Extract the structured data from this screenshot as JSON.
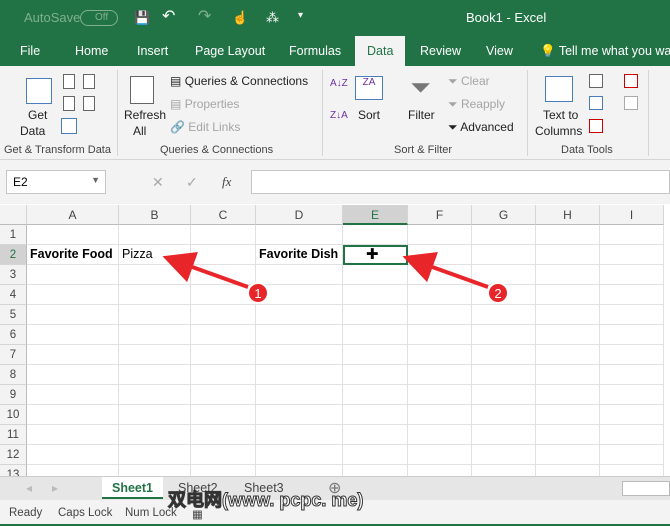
{
  "titlebar": {
    "autosave": "AutoSave",
    "toggle": "Off",
    "title": "Book1  -  Excel"
  },
  "tabs": [
    "File",
    "Home",
    "Insert",
    "Page Layout",
    "Formulas",
    "Data",
    "Review",
    "View",
    "Tell me what you want"
  ],
  "active_tab": "Data",
  "ribbon": {
    "get_data": "Get",
    "get_data2": "Data",
    "queries_connections": "Queries & Connections",
    "properties": "Properties",
    "edit_links": "Edit Links",
    "refresh": "Refresh",
    "refresh2": "All",
    "sort": "Sort",
    "filter": "Filter",
    "clear": "Clear",
    "reapply": "Reapply",
    "advanced": "Advanced",
    "text_to": "Text to",
    "columns": "Columns",
    "groups": [
      "Get & Transform Data",
      "Queries & Connections",
      "Sort & Filter",
      "Data Tools"
    ]
  },
  "formula_bar": {
    "name_box": "E2",
    "fx": "fx",
    "value": ""
  },
  "columns": [
    "A",
    "B",
    "C",
    "D",
    "E",
    "F",
    "G",
    "H",
    "I"
  ],
  "rows": [
    "1",
    "2",
    "3",
    "4",
    "5",
    "6",
    "7",
    "8",
    "9",
    "10",
    "11",
    "12",
    "13"
  ],
  "cells": {
    "A2": "Favorite Food",
    "B2": "Pizza",
    "D2": "Favorite Dish",
    "E2": ""
  },
  "selected_cell": "E2",
  "annotations": [
    "1",
    "2"
  ],
  "annotation_color": "#e8262a",
  "accent": "#217346",
  "sheets": [
    "Sheet1",
    "Sheet2",
    "Sheet3"
  ],
  "active_sheet": "Sheet1",
  "status": [
    "Ready",
    "Caps Lock",
    "Num Lock"
  ],
  "watermark": "双电网(www. pcpc. me)"
}
